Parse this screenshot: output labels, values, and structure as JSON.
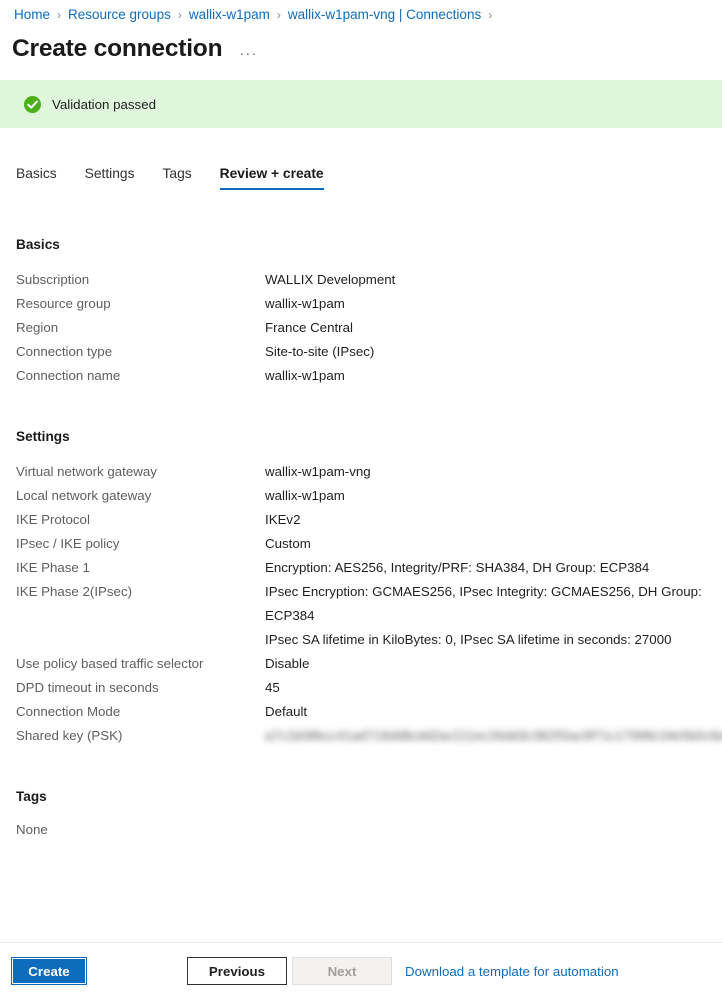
{
  "breadcrumb": {
    "separator": "›",
    "items": [
      {
        "label": "Home"
      },
      {
        "label": "Resource groups"
      },
      {
        "label": "wallix-w1pam"
      },
      {
        "label": "wallix-w1pam-vng | Connections"
      }
    ]
  },
  "header": {
    "title": "Create connection",
    "more_label": "···"
  },
  "banner": {
    "icon": "success-check-icon",
    "text": "Validation passed",
    "background": "#dff6dd",
    "icon_color": "#4caf17"
  },
  "tabs": [
    {
      "label": "Basics",
      "active": false
    },
    {
      "label": "Settings",
      "active": false
    },
    {
      "label": "Tags",
      "active": false
    },
    {
      "label": "Review + create",
      "active": true
    }
  ],
  "sections": {
    "basics": {
      "title": "Basics",
      "rows": [
        {
          "label": "Subscription",
          "value": "WALLIX Development"
        },
        {
          "label": "Resource group",
          "value": "wallix-w1pam"
        },
        {
          "label": "Region",
          "value": "France Central"
        },
        {
          "label": "Connection type",
          "value": "Site-to-site (IPsec)"
        },
        {
          "label": "Connection name",
          "value": "wallix-w1pam"
        }
      ]
    },
    "settings": {
      "title": "Settings",
      "rows": [
        {
          "label": "Virtual network gateway",
          "value": "wallix-w1pam-vng"
        },
        {
          "label": "Local network gateway",
          "value": "wallix-w1pam"
        },
        {
          "label": "IKE Protocol",
          "value": "IKEv2"
        },
        {
          "label": "IPsec / IKE policy",
          "value": "Custom"
        },
        {
          "label": "IKE Phase 1",
          "value": "Encryption: AES256, Integrity/PRF: SHA384, DH Group: ECP384"
        },
        {
          "label": "IKE Phase 2(IPsec)",
          "value": "IPsec Encryption: GCMAES256, IPsec Integrity: GCMAES256, DH Group: ECP384\nIPsec SA lifetime in KiloBytes: 0,  IPsec SA lifetime in seconds: 27000"
        },
        {
          "label": "Use policy based traffic selector",
          "value": "Disable"
        },
        {
          "label": "DPD timeout in seconds",
          "value": "45"
        },
        {
          "label": "Connection Mode",
          "value": "Default"
        },
        {
          "label": "Shared key (PSK)",
          "value": "a7c1b08bcc41ad718dd8cdd2ac211ec26dd3c38255ac9f71c17998c34e5b0c6e5cce8",
          "redacted": true
        }
      ]
    },
    "tags": {
      "title": "Tags",
      "empty_text": "None"
    }
  },
  "footer": {
    "create_label": "Create",
    "previous_label": "Previous",
    "next_label": "Next",
    "download_link_label": "Download a template for automation",
    "accent_color": "#0f6cbd"
  }
}
